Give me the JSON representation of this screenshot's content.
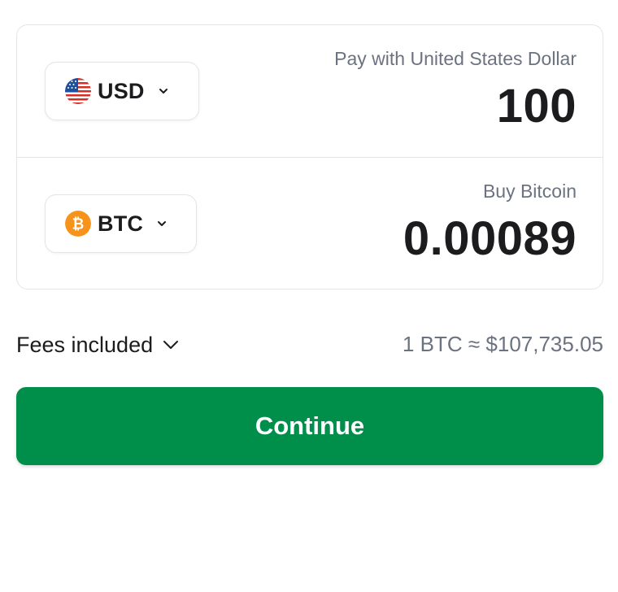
{
  "pay": {
    "currency_code": "USD",
    "currency_icon": "us-flag-icon",
    "label": "Pay with United States Dollar",
    "amount": "100"
  },
  "buy": {
    "currency_code": "BTC",
    "currency_icon": "bitcoin-icon",
    "label": "Buy Bitcoin",
    "amount": "0.00089"
  },
  "fees": {
    "label": "Fees included"
  },
  "rate": {
    "text": "1 BTC ≈ $107,735.05"
  },
  "continue_button": {
    "label": "Continue",
    "color": "#008f4b"
  },
  "colors": {
    "bitcoin_orange": "#f7931a",
    "text_primary": "#1c1c1e",
    "text_secondary": "#6b7280",
    "border": "#e3e5e8"
  }
}
